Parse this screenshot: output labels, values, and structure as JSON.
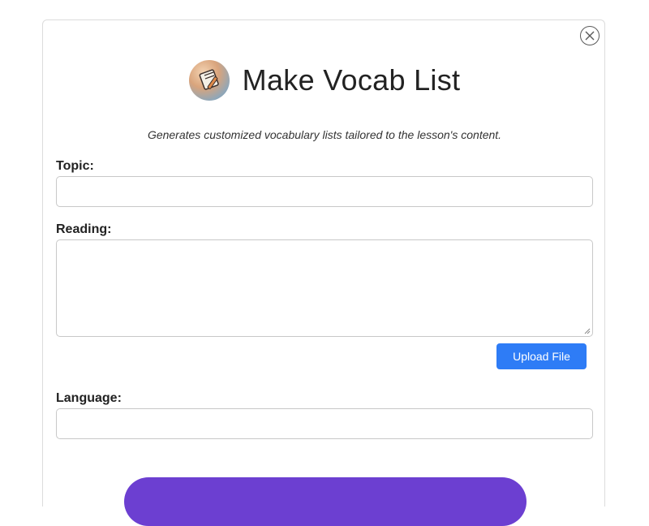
{
  "dialog": {
    "title": "Make Vocab List",
    "subtitle": "Generates customized vocabulary lists tailored to the lesson's content.",
    "close_icon": "close-circle-icon",
    "logo_icon": "notebook-pencil-logo"
  },
  "form": {
    "topic": {
      "label": "Topic:",
      "value": ""
    },
    "reading": {
      "label": "Reading:",
      "value": ""
    },
    "upload_label": "Upload File",
    "language": {
      "label": "Language:",
      "value": ""
    }
  },
  "colors": {
    "upload_button": "#2e7cf6",
    "submit_button": "#6c3fd1"
  }
}
